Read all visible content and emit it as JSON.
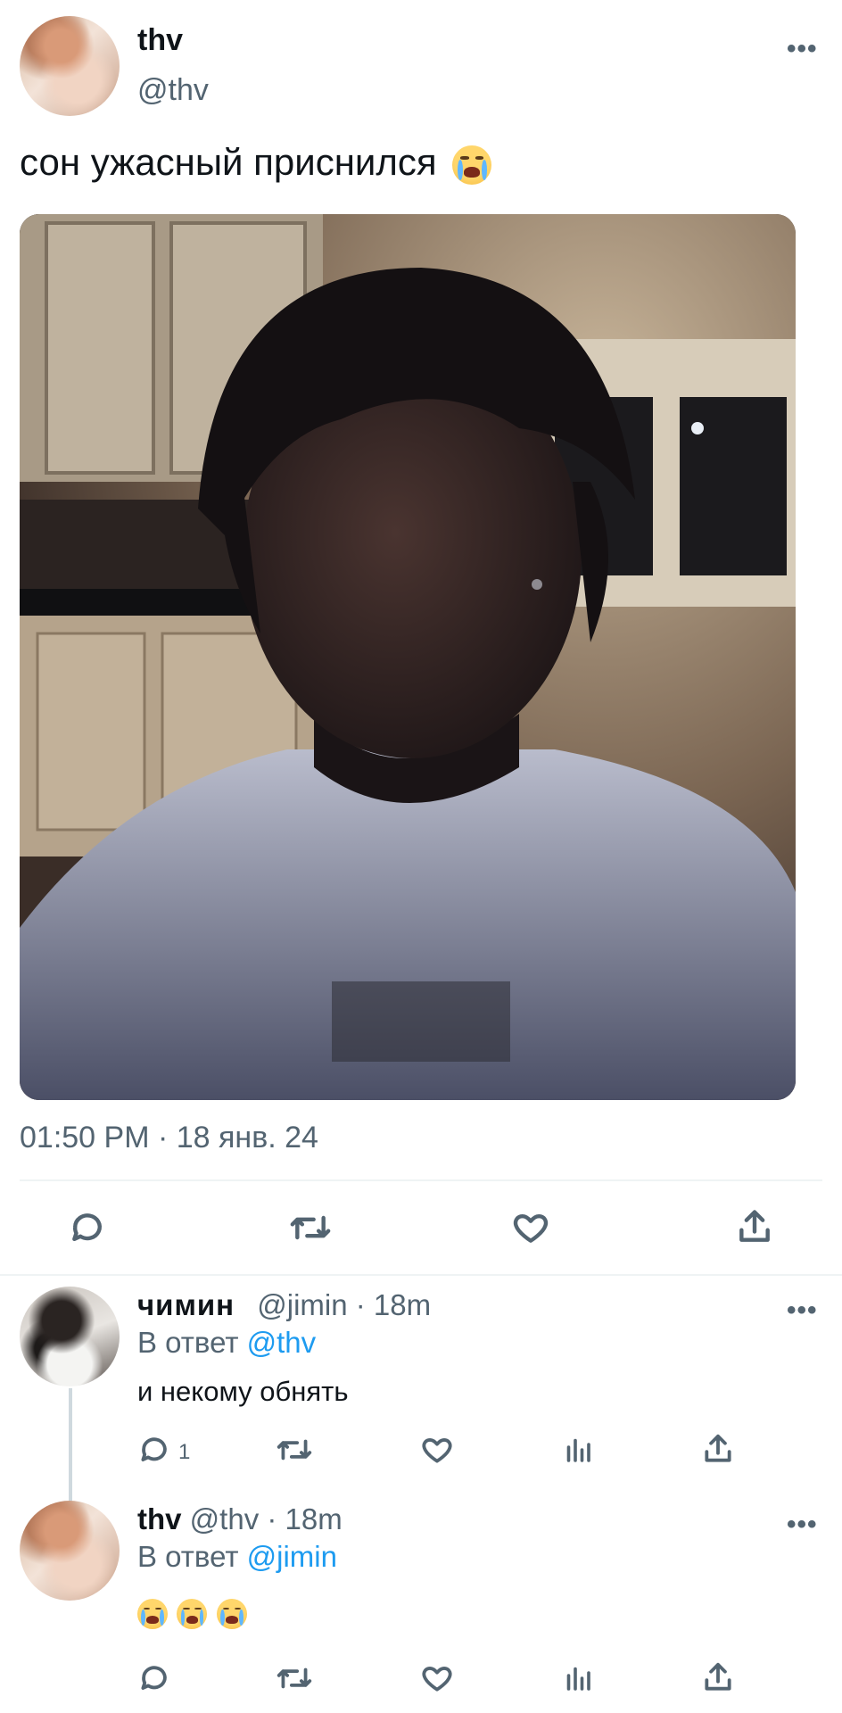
{
  "main_tweet": {
    "author_name": "thv",
    "author_handle": "@thv",
    "more_label": "•••",
    "text": "сон ужасный приснился",
    "text_emoji": "loudly-crying-face",
    "timestamp": "01:50 PM · 18 янв. 24",
    "actions": [
      "reply",
      "retweet",
      "like",
      "share"
    ]
  },
  "replies": [
    {
      "author_name": "чимин",
      "author_handle": "@jimin",
      "time": "· 18m",
      "reply_to_prefix": "В ответ",
      "reply_to_handle": "@thv",
      "text": "и некому обнять",
      "reply_count": "1",
      "more_label": "•••"
    },
    {
      "author_name": "thv",
      "author_handle": "@thv",
      "time": "· 18m",
      "reply_to_prefix": "В ответ",
      "reply_to_handle": "@jimin",
      "text_emoji": [
        "loudly-crying-face",
        "loudly-crying-face",
        "loudly-crying-face"
      ],
      "more_label": "•••"
    }
  ],
  "colors": {
    "accent": "#1d9bf0",
    "secondary_text": "#536471",
    "divider": "#eff3f4"
  }
}
